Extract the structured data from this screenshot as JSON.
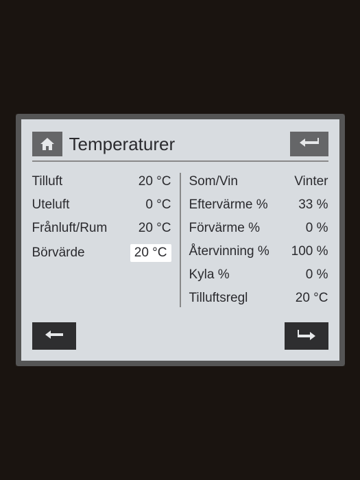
{
  "header": {
    "title": "Temperaturer"
  },
  "left": [
    {
      "label": "Tilluft",
      "value": "20 °C"
    },
    {
      "label": "Uteluft",
      "value": "0 °C"
    },
    {
      "label": "Frånluft/Rum",
      "value": "20 °C"
    },
    {
      "label": "Börvärde",
      "value": "20 °C",
      "highlighted": true
    }
  ],
  "right": [
    {
      "label": "Som/Vin",
      "value": "Vinter"
    },
    {
      "label": "Eftervärme %",
      "value": "33 %"
    },
    {
      "label": "Förvärme %",
      "value": "0 %"
    },
    {
      "label": "Återvinning %",
      "value": "100 %"
    },
    {
      "label": "Kyla %",
      "value": "0 %"
    },
    {
      "label": "Tilluftsregl",
      "value": "20 °C"
    }
  ]
}
